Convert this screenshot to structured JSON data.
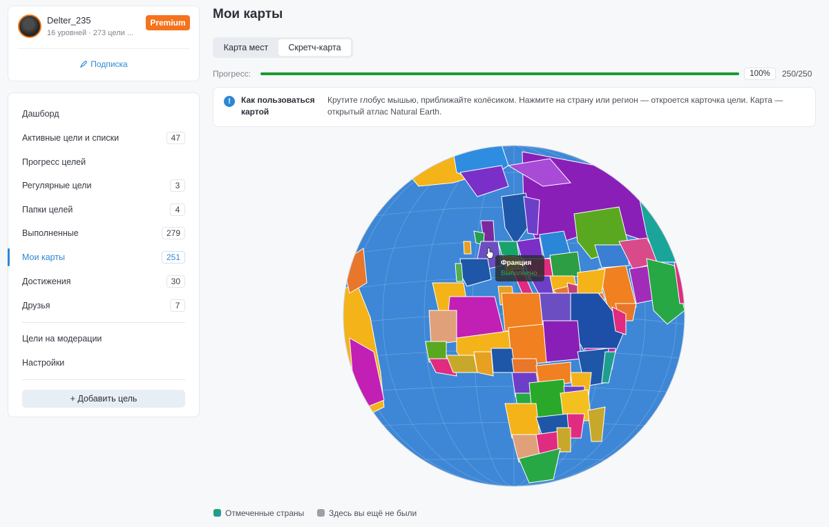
{
  "profile": {
    "username": "Delter_235",
    "meta": "16 уровней · 273 цели ...",
    "badge": "Premium",
    "subscription_link": "Подписка"
  },
  "nav": {
    "items": [
      {
        "label": "Дашборд",
        "count": null
      },
      {
        "label": "Активные цели и списки",
        "count": "47"
      },
      {
        "label": "Прогресс целей",
        "count": null
      },
      {
        "label": "Регулярные цели",
        "count": "3"
      },
      {
        "label": "Папки целей",
        "count": "4"
      },
      {
        "label": "Выполненные",
        "count": "279"
      },
      {
        "label": "Мои карты",
        "count": "251",
        "active": true
      },
      {
        "label": "Достижения",
        "count": "30"
      },
      {
        "label": "Друзья",
        "count": "7"
      }
    ],
    "secondary": [
      {
        "label": "Цели на модерации"
      },
      {
        "label": "Настройки"
      }
    ],
    "add_button": "+ Добавить цель"
  },
  "main": {
    "title": "Мои карты",
    "tabs": [
      "Карта мест",
      "Скретч-карта"
    ],
    "active_tab": "Скретч-карта",
    "progress": {
      "label": "Прогресс:",
      "percent_text": "100%",
      "fraction": 1.0,
      "count_text": "250/250"
    },
    "info": {
      "title": "Как пользоваться картой",
      "text": "Крутите глобус мышью, приближайте колёсиком. Нажмите на страну или регион — откроется карточка цели. Карта — открытый атлас Natural Earth."
    },
    "tooltip": {
      "country": "Франция",
      "status": "Выполнено"
    },
    "legend": [
      {
        "label": "Отмеченные страны",
        "color": "#1f9e8f"
      },
      {
        "label": "Здесь вы ещё не были",
        "color": "#9aa1ab"
      }
    ]
  },
  "colors": {
    "accent": "#2e87d4",
    "premium": "#f5731c",
    "progress": "#1a9a31",
    "ocean": "#3d87d6"
  }
}
